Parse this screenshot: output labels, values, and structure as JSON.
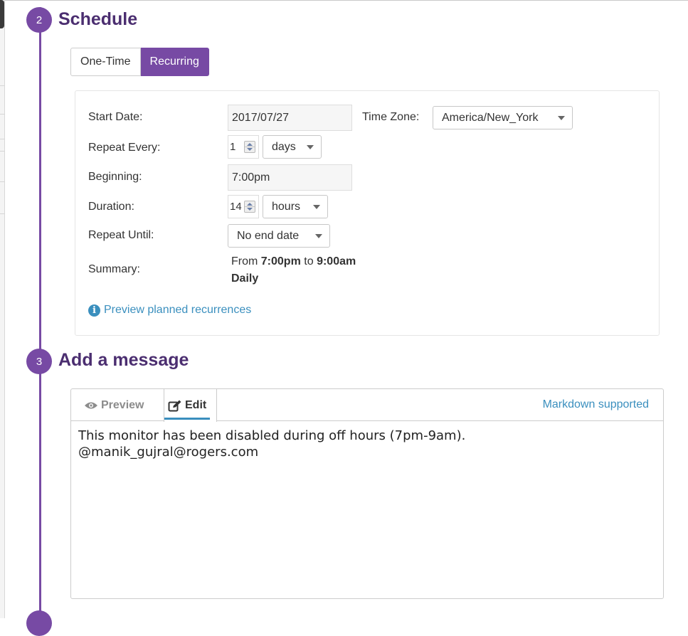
{
  "steps": {
    "schedule": {
      "number": "2",
      "title": "Schedule"
    },
    "message": {
      "number": "3",
      "title": "Add a message"
    }
  },
  "schedule_type": {
    "options": [
      "One-Time",
      "Recurring"
    ],
    "selected": "Recurring"
  },
  "form": {
    "start_date": {
      "label": "Start Date:",
      "value": "2017/07/27"
    },
    "time_zone": {
      "label": "Time Zone:",
      "value": "America/New_York"
    },
    "repeat_every": {
      "label": "Repeat Every:",
      "value": "1",
      "unit": "days"
    },
    "beginning": {
      "label": "Beginning:",
      "value": "7:00pm"
    },
    "duration": {
      "label": "Duration:",
      "value": "14",
      "unit": "hours"
    },
    "repeat_until": {
      "label": "Repeat Until:",
      "value": "No end date"
    },
    "summary": {
      "label": "Summary:",
      "from_word": "From",
      "from_time": "7:00pm",
      "to_word": "to",
      "to_time": "9:00am",
      "frequency": "Daily"
    },
    "preview_link": "Preview planned recurrences"
  },
  "editor": {
    "tabs": {
      "preview": "Preview",
      "edit": "Edit",
      "active": "Edit"
    },
    "markdown_note": "Markdown supported",
    "message": "This monitor has been disabled during off hours (7pm-9am).\n@manik_gujral@rogers.com"
  },
  "icons": {
    "preview_tab": "eye-icon",
    "edit_tab": "edit-icon",
    "preview_link": "info-icon"
  },
  "colors": {
    "accent": "#774aa4",
    "title": "#4b2e70",
    "link": "#3a8fbe"
  }
}
